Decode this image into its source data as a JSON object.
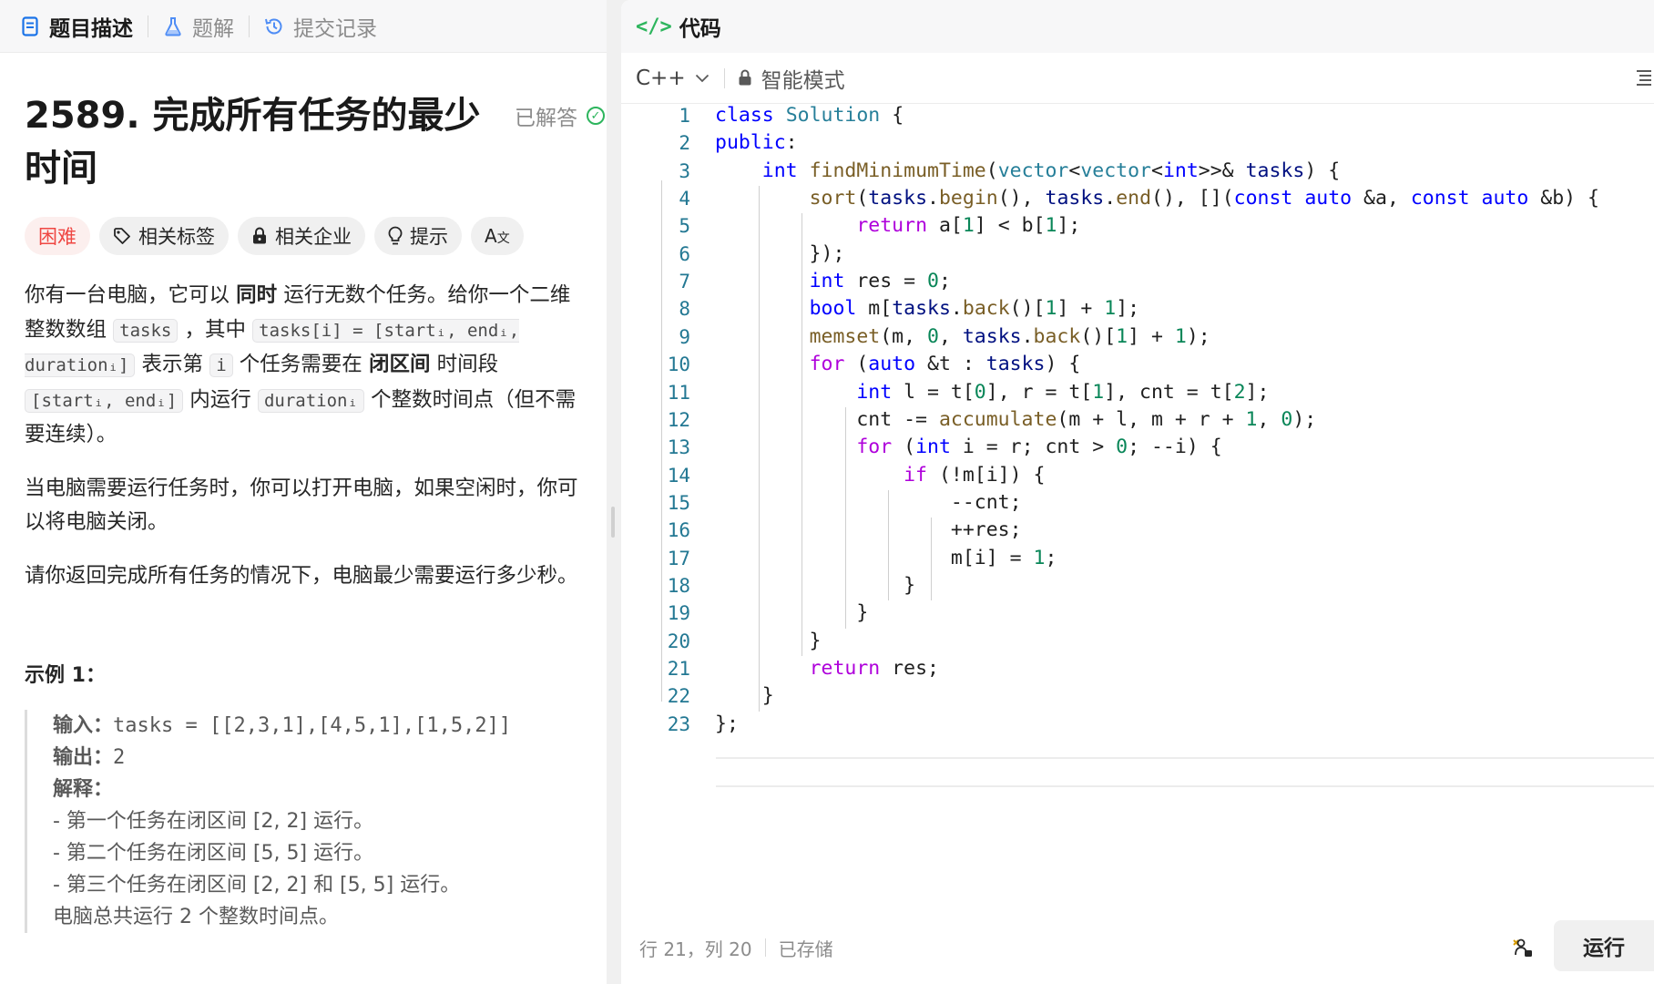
{
  "left_tabs": [
    {
      "label": "题目描述",
      "active": true,
      "icon": "document-icon"
    },
    {
      "label": "题解",
      "active": false,
      "icon": "flask-icon"
    },
    {
      "label": "提交记录",
      "active": false,
      "icon": "history-icon"
    }
  ],
  "problem": {
    "title": "2589. 完成所有任务的最少时间",
    "status": "已解答",
    "tags": {
      "difficulty": "困难",
      "related_tags": "相关标签",
      "related_companies": "相关企业",
      "hint": "提示"
    },
    "para1": {
      "t1": "你有一台电脑，它可以 ",
      "b1": "同时",
      "t2": " 运行无数个任务。给你一个二维整数数组 ",
      "c1": "tasks",
      "t3": " ，其中 ",
      "c2": "tasks[i] = [startᵢ, endᵢ, durationᵢ]",
      "t4": " 表示第 ",
      "c3": "i",
      "t5": " 个任务需要在 ",
      "b2": "闭区间",
      "t6": " 时间段 ",
      "c4": "[startᵢ, endᵢ]",
      "t7": " 内运行 ",
      "c5": "durationᵢ",
      "t8": " 个整数时间点（但不需要连续）。"
    },
    "para2": "当电脑需要运行任务时，你可以打开电脑，如果空闲时，你可以将电脑关闭。",
    "para3": "请你返回完成所有任务的情况下，电脑最少需要运行多少秒。",
    "example_title": "示例 1：",
    "example": {
      "input_label": "输入：",
      "input_value": "tasks = [[2,3,1],[4,5,1],[1,5,2]]",
      "output_label": "输出：",
      "output_value": "2",
      "explain_label": "解释：",
      "lines": [
        "- 第一个任务在闭区间 [2, 2] 运行。",
        "- 第二个任务在闭区间 [5, 5] 运行。",
        "- 第三个任务在闭区间 [2, 2] 和 [5, 5] 运行。",
        "电脑总共运行 2 个整数时间点。"
      ]
    }
  },
  "editor": {
    "header_title": "代码",
    "language": "C++",
    "mode": "智能模式",
    "code_lines": [
      "class Solution {",
      "public:",
      "    int findMinimumTime(vector<vector<int>>& tasks) {",
      "        sort(tasks.begin(), tasks.end(), [](const auto &a, const auto &b) {",
      "            return a[1] < b[1];",
      "        });",
      "        int res = 0;",
      "        bool m[tasks.back()[1] + 1];",
      "        memset(m, 0, tasks.back()[1] + 1);",
      "        for (auto &t : tasks) {",
      "            int l = t[0], r = t[1], cnt = t[2];",
      "            cnt -= accumulate(m + l, m + r + 1, 0);",
      "            for (int i = r; cnt > 0; --i) {",
      "                if (!m[i]) {",
      "                    --cnt;",
      "                    ++res;",
      "                    m[i] = 1;",
      "                }",
      "            }",
      "        }",
      "        return res;",
      "    }",
      "};"
    ],
    "cursor_position": "行 21，列 20",
    "save_status": "已存储",
    "run_label": "运行"
  },
  "colors": {
    "accent_green": "#2db55d",
    "difficulty_red": "#ef4743",
    "keyword": "#0000ff",
    "control": "#af00db",
    "type": "#267f99",
    "function": "#795e26",
    "number": "#098658",
    "line_number": "#237893"
  }
}
